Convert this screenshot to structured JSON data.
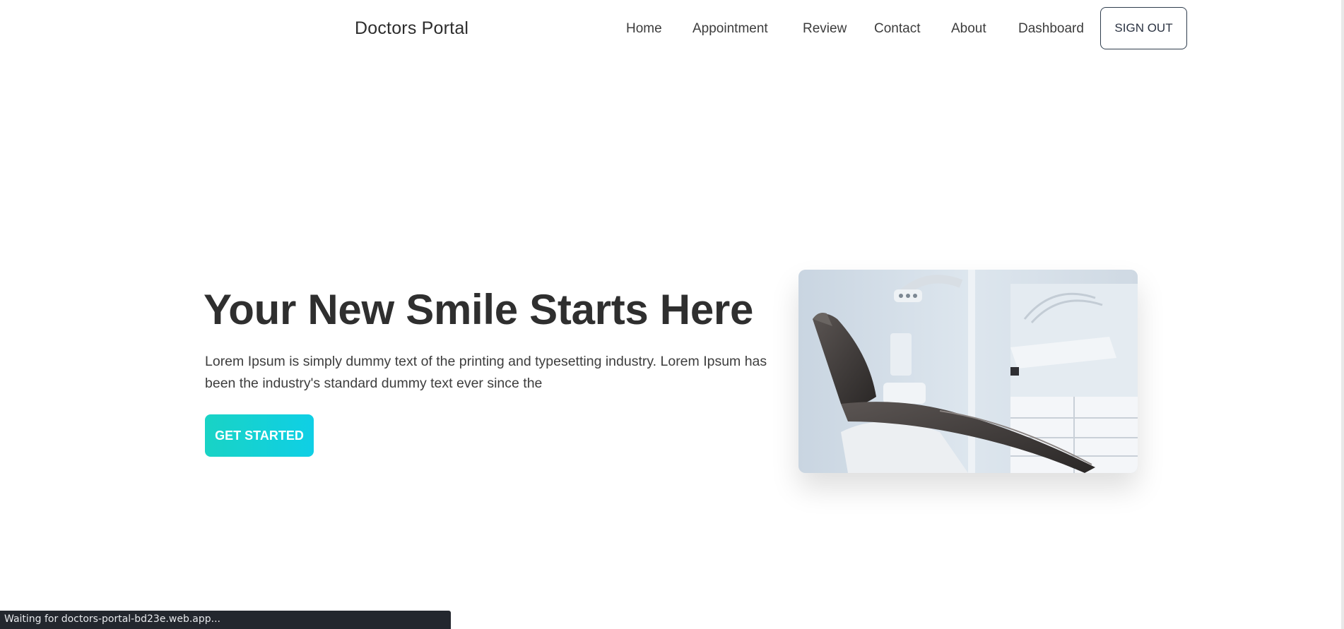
{
  "brand": "Doctors Portal",
  "nav": {
    "items": [
      {
        "label": "Home"
      },
      {
        "label": "Appointment"
      },
      {
        "label": "Review"
      },
      {
        "label": "Contact"
      },
      {
        "label": "About"
      },
      {
        "label": "Dashboard"
      }
    ],
    "sign_out_label": "SIGN OUT"
  },
  "hero": {
    "title": "Your New Smile Starts Here",
    "text": "Lorem Ipsum is simply dummy text of the printing and typesetting industry. Lorem Ipsum has been the industry's standard dummy text ever since the",
    "cta_label": "GET STARTED"
  },
  "status_bar": "Waiting for doctors-portal-bd23e.web.app...",
  "colors": {
    "cta_gradient_start": "#19d3c5",
    "cta_gradient_end": "#0fcfe5",
    "status_bar_bg": "#23272e",
    "text_dark": "#2f2f2f"
  },
  "icons": {
    "hero_image": "dental-chair-image"
  }
}
